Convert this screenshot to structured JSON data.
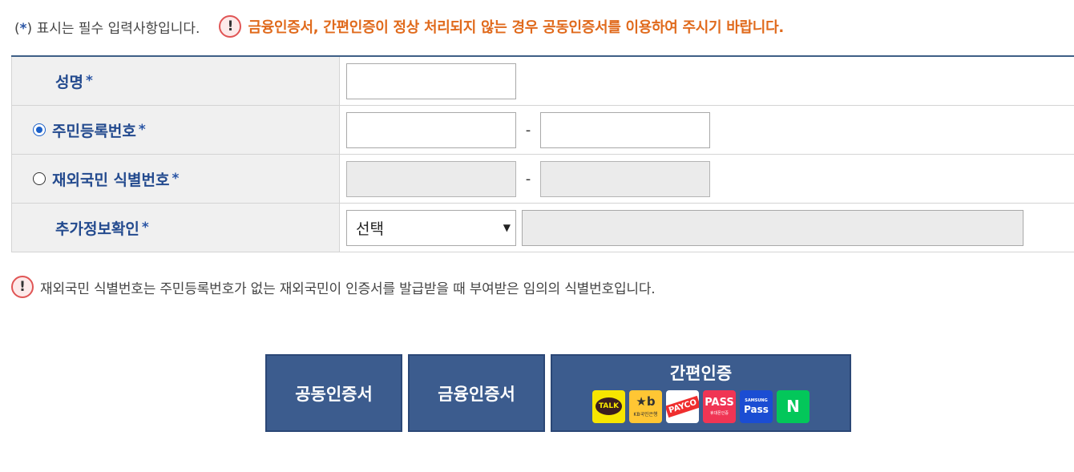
{
  "header": {
    "required_prefix": "(",
    "required_star": "*",
    "required_text": ") 표시는 필수 입력사항입니다.",
    "alert_icon": "!",
    "alert_text": "금융인증서, 간편인증이 정상 처리되지 않는 경우 공동인증서를 이용하여 주시기 바랍니다."
  },
  "form": {
    "name_label": "성명",
    "resident_label": "주민등록번호",
    "foreign_label": "재외국민 식별번호",
    "extra_label": "추가정보확인",
    "required_star": "*",
    "dash": "-",
    "select_value": "선택",
    "select_arrow": "▼",
    "selected_radio": "resident"
  },
  "note": {
    "icon": "!",
    "text": "재외국민 식별번호는 주민등록번호가 없는 재외국민이 인증서를 발급받을 때 부여받은 임의의 식별번호입니다."
  },
  "buttons": {
    "joint_cert": "공동인증서",
    "financial_cert": "금융인증서",
    "simple_auth": "간편인증"
  },
  "services": {
    "kakao": "TALK",
    "kb_logo": "★b",
    "kb_sub": "KB국민은행",
    "payco": "PAYCO",
    "pass": "PASS",
    "pass_sub": "휴대폰인증",
    "samsung_sub": "SAMSUNG",
    "samsung": "Pass",
    "naver": "N"
  },
  "icons": {
    "alert": "alert-icon",
    "required": "asterisk-icon",
    "select": "chevron-down-icon"
  },
  "colors": {
    "alert_text": "#e06a1c",
    "label_text": "#234a8e",
    "button_bg": "#3c5c8e",
    "header_border": "#3e5f86"
  }
}
